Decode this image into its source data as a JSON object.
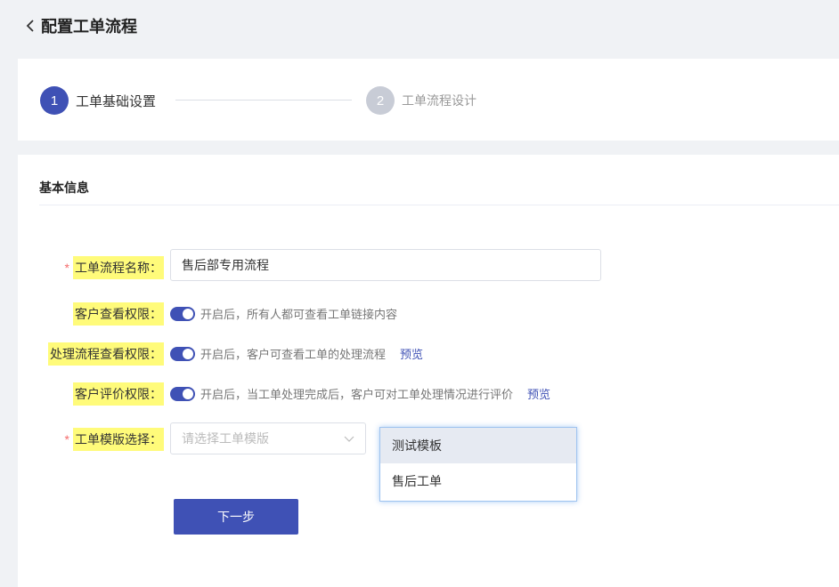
{
  "header": {
    "title": "配置工单流程"
  },
  "steps": [
    {
      "number": "1",
      "label": "工单基础设置"
    },
    {
      "number": "2",
      "label": "工单流程设计"
    }
  ],
  "section": {
    "title": "基本信息"
  },
  "form": {
    "name": {
      "label": "工单流程名称：",
      "value": "售后部专用流程"
    },
    "customer_view": {
      "label": "客户查看权限：",
      "enabled": true,
      "description": "开启后，所有人都可查看工单链接内容"
    },
    "process_view": {
      "label": "处理流程查看权限：",
      "enabled": true,
      "description": "开启后，客户可查看工单的处理流程",
      "preview": "预览"
    },
    "customer_rating": {
      "label": "客户评价权限：",
      "enabled": true,
      "description": "开启后，当工单处理完成后，客户可对工单处理情况进行评价",
      "preview": "预览"
    },
    "template": {
      "label": "工单模版选择：",
      "placeholder": "请选择工单模版"
    }
  },
  "dropdown": {
    "options": [
      "测试模板",
      "售后工单"
    ]
  },
  "next_button": "下一步",
  "required_mark": "*",
  "colors": {
    "primary": "#3f51b5",
    "highlight": "#fffb7a",
    "required": "#f56c6c"
  }
}
